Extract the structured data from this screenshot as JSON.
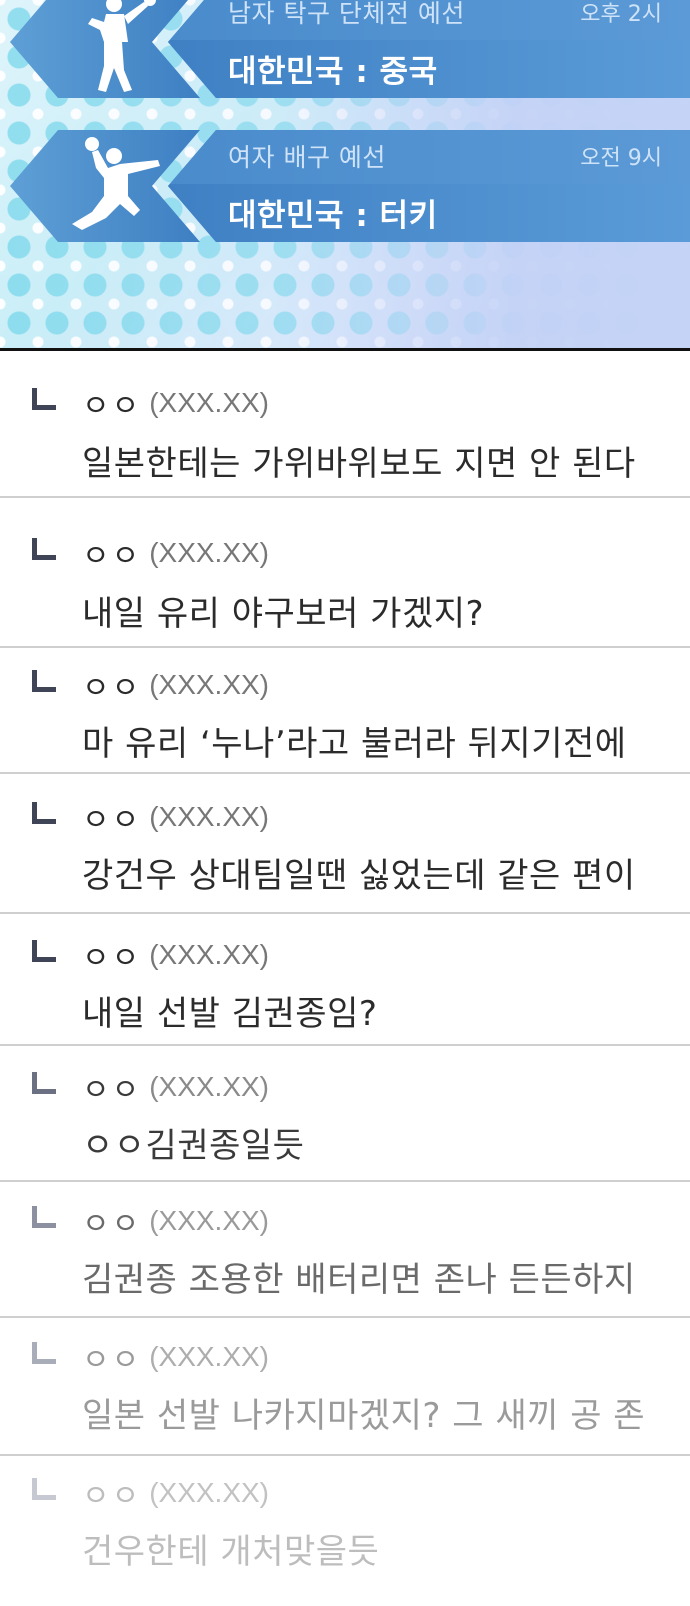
{
  "schedule": [
    {
      "event": "남자 탁구 단체전 예선",
      "time": "오후 2시",
      "matchup": "대한민국 : 중국",
      "icon": "table-tennis-player-icon"
    },
    {
      "event": "여자 배구 예선",
      "time": "오전 9시",
      "matchup": "대한민국 : 터키",
      "icon": "volleyball-player-icon"
    }
  ],
  "comments": [
    {
      "author": "ㅇㅇ",
      "ip": "(XXX.XX)",
      "text": "일본한테는 가위바위보도 지면 안 된다"
    },
    {
      "author": "ㅇㅇ",
      "ip": "(XXX.XX)",
      "text": "내일 유리 야구보러 가겠지?"
    },
    {
      "author": "ㅇㅇ",
      "ip": "(XXX.XX)",
      "text": "마 유리 ‘누나’라고 불러라 뒤지기전에"
    },
    {
      "author": "ㅇㅇ",
      "ip": "(XXX.XX)",
      "text": "강건우 상대팀일땐 싫었는데 같은 편이"
    },
    {
      "author": "ㅇㅇ",
      "ip": "(XXX.XX)",
      "text": "내일 선발 김권종임?"
    },
    {
      "author": "ㅇㅇ",
      "ip": "(XXX.XX)",
      "text": "ㅇㅇ김권종일듯"
    },
    {
      "author": "ㅇㅇ",
      "ip": "(XXX.XX)",
      "text": "김권종 조용한 배터리면 존나 든든하지"
    },
    {
      "author": "ㅇㅇ",
      "ip": "(XXX.XX)",
      "text": "일본 선발 나카지마겠지? 그 새끼 공 존"
    },
    {
      "author": "ㅇㅇ",
      "ip": "(XXX.XX)",
      "text": "건우한테 개처맞을듯"
    }
  ],
  "colors": {
    "banner_blue": "#3f7fc2",
    "comment_text": "#222222",
    "fade_text": "#b5b5b5"
  }
}
